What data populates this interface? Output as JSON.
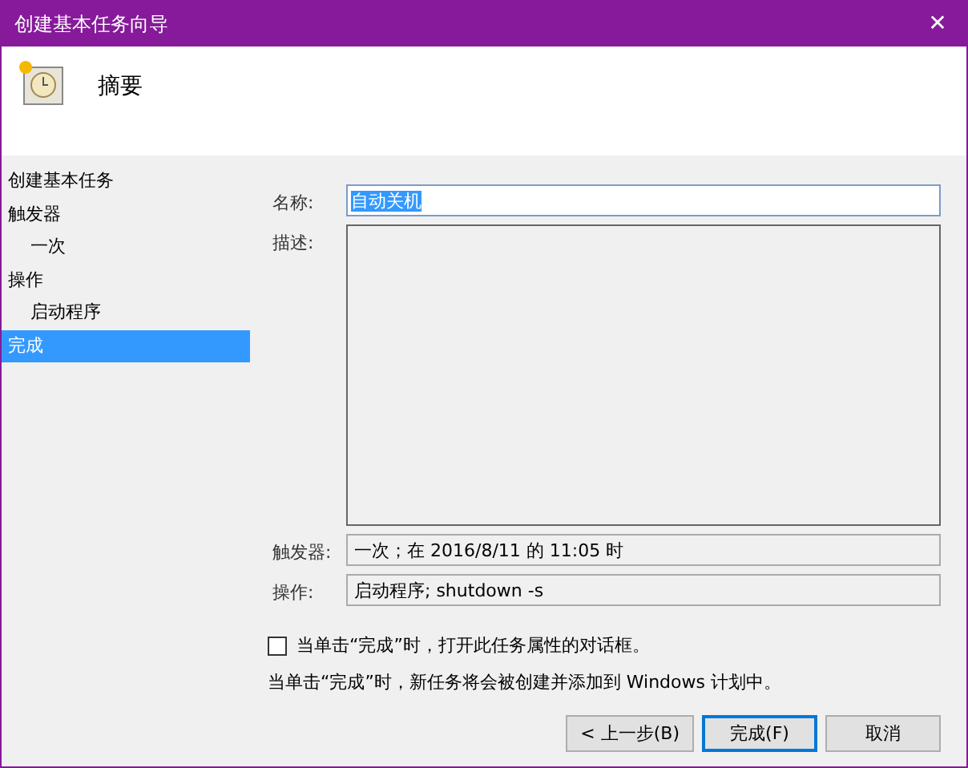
{
  "window": {
    "title": "创建基本任务向导",
    "close": "✕"
  },
  "header": {
    "title": "摘要"
  },
  "steps": [
    {
      "label": "创建基本任务",
      "selected": false
    },
    {
      "label": "触发器",
      "selected": false,
      "children": [
        {
          "label": "一次",
          "selected": false
        }
      ]
    },
    {
      "label": "操作",
      "selected": false,
      "children": [
        {
          "label": "启动程序",
          "selected": false
        }
      ]
    },
    {
      "label": "完成",
      "selected": true
    }
  ],
  "form": {
    "name_label": "名称:",
    "name_value": "自动关机",
    "name_text_selected": true,
    "description_label": "描述:",
    "trigger_label": "触发器:",
    "trigger_value": "一次；在 2016/8/11 的 11:05 时",
    "action_label": "操作:",
    "action_value": "启动程序; shutdown -s"
  },
  "open_properties": {
    "label": "当单击“完成”时，打开此任务属性的对话框。",
    "checked": false
  },
  "note": "当单击“完成”时，新任务将会被创建并添加到 Windows 计划中。",
  "buttons": [
    {
      "label": "< 上一步(B)",
      "kind": "normal"
    },
    {
      "label": "完成(F)",
      "kind": "default"
    },
    {
      "label": "取消",
      "kind": "normal"
    }
  ]
}
